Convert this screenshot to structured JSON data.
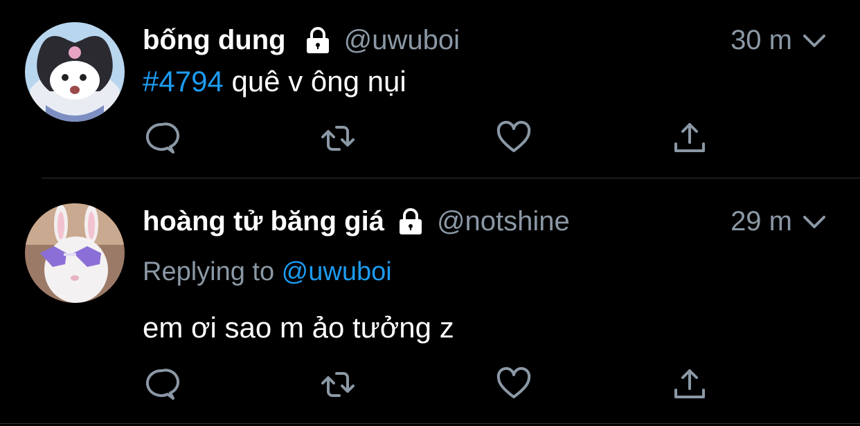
{
  "colors": {
    "background": "#000000",
    "text": "#ffffff",
    "muted": "#8b98a5",
    "link": "#1d9bf0",
    "divider": "#2f3336"
  },
  "tweets": [
    {
      "display_name": "bống dung",
      "handle": "@uwuboi",
      "time": "30 m",
      "hashtag": "#4794",
      "text": " quê v ông nụi",
      "avatar_icon": "kuromi-avatar",
      "lock_icon": "lock-icon"
    },
    {
      "display_name": "hoàng tử băng giá",
      "handle": "@notshine",
      "time": "29 m",
      "replying_label": "Replying to ",
      "replying_to": "@uwuboi",
      "text": "em ơi sao m ảo tưởng z",
      "avatar_icon": "bunny-sunglasses-avatar",
      "lock_icon": "lock-icon"
    }
  ],
  "actions": {
    "icons": [
      "reply-icon",
      "retweet-icon",
      "like-icon",
      "share-icon"
    ]
  }
}
